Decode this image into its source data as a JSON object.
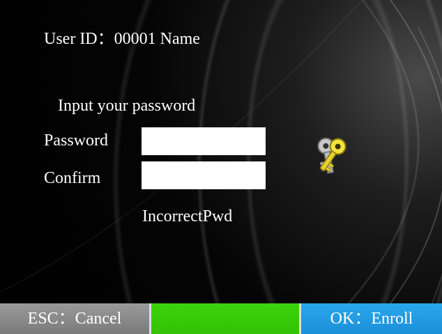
{
  "screen": {
    "user_line": "User ID：00001 Name",
    "prompt": "Input your password",
    "password_label": "Password",
    "confirm_label": "Confirm",
    "password_value": "",
    "confirm_value": "",
    "message": "IncorrectPwd"
  },
  "icons": {
    "keys": "keys-icon"
  },
  "softkeys": {
    "esc_label": "ESC：Cancel",
    "middle_label": "",
    "ok_label": "OK：Enroll"
  },
  "colors": {
    "background": "#000000",
    "esc_button": "#8a8a8a",
    "middle_button": "#36c908",
    "ok_button": "#2299e2",
    "text": "#ffffff"
  }
}
